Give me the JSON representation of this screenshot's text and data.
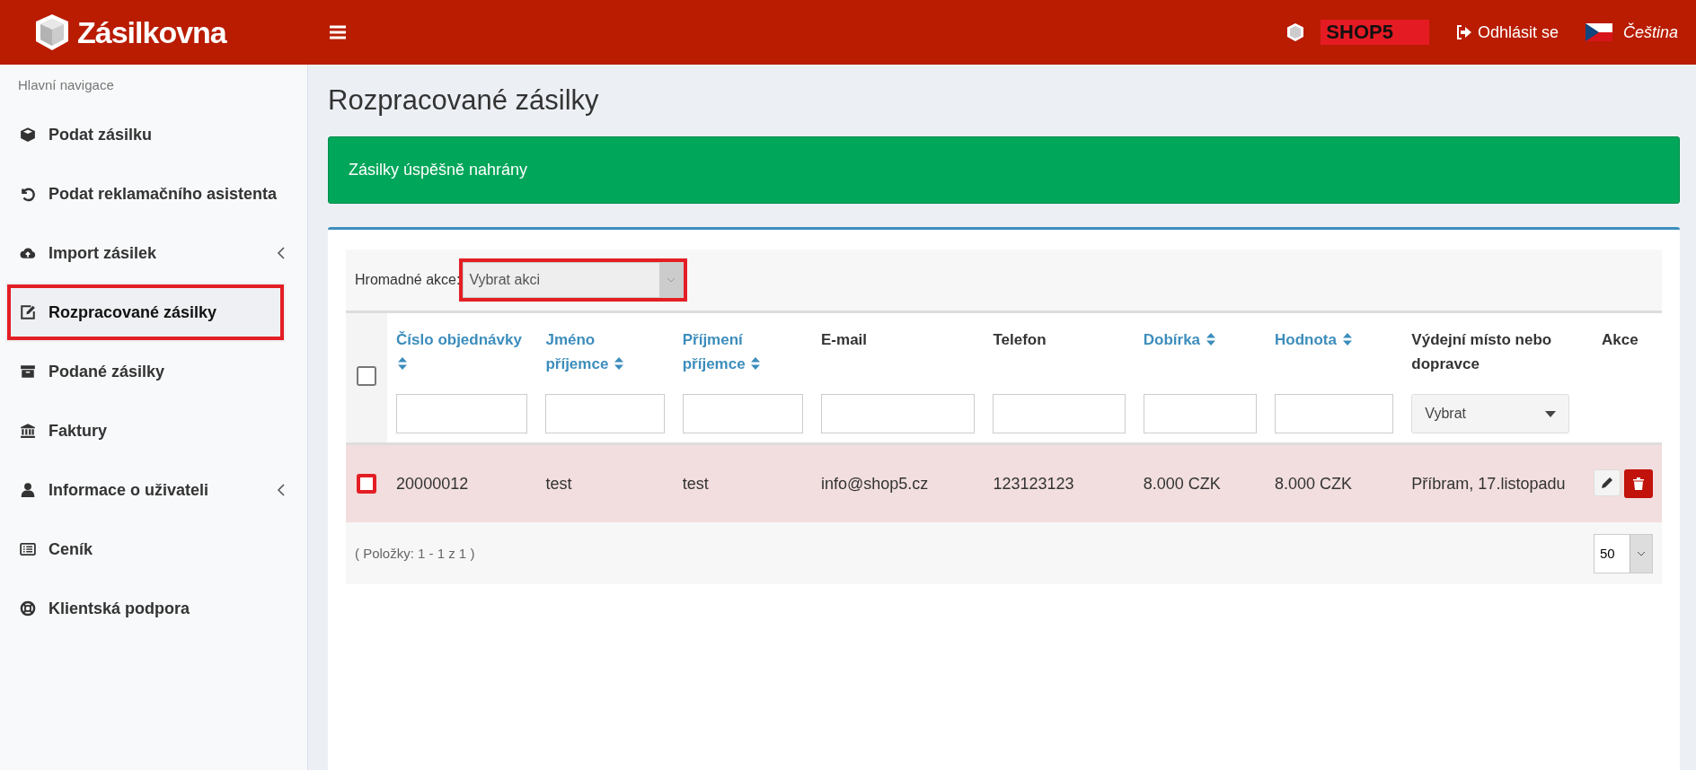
{
  "header": {
    "brand": "Zásilkovna",
    "shop": "SHOP5",
    "logout": "Odhlásit se",
    "language": "Čeština"
  },
  "sidebar": {
    "heading": "Hlavní navigace",
    "items": [
      {
        "label": "Podat zásilku",
        "selected": false,
        "highlighted": false,
        "submenu": false
      },
      {
        "label": "Podat reklamačního asistenta",
        "selected": false,
        "highlighted": false,
        "submenu": false
      },
      {
        "label": "Import zásilek",
        "selected": false,
        "highlighted": false,
        "submenu": true
      },
      {
        "label": "Rozpracované zásilky",
        "selected": true,
        "highlighted": true,
        "submenu": false
      },
      {
        "label": "Podané zásilky",
        "selected": false,
        "highlighted": false,
        "submenu": false
      },
      {
        "label": "Faktury",
        "selected": false,
        "highlighted": false,
        "submenu": false
      },
      {
        "label": "Informace o uživateli",
        "selected": false,
        "highlighted": false,
        "submenu": true
      },
      {
        "label": "Ceník",
        "selected": false,
        "highlighted": false,
        "submenu": false
      },
      {
        "label": "Klientská podpora",
        "selected": false,
        "highlighted": false,
        "submenu": false
      }
    ]
  },
  "page_title": "Rozpracované zásilky",
  "alert": "Zásilky úspěšně nahrány",
  "bulk": {
    "label": "Hromadné akce:",
    "value": "Vybrat akci",
    "highlighted": true
  },
  "table": {
    "select_all_checked": false,
    "columns": [
      {
        "label": "Číslo objednávky",
        "sortable": true,
        "kind": "text"
      },
      {
        "label": "Jméno příjemce",
        "sortable": true,
        "kind": "text"
      },
      {
        "label": "Příjmení příjemce",
        "sortable": true,
        "kind": "text"
      },
      {
        "label": "E-mail",
        "sortable": false,
        "kind": "text"
      },
      {
        "label": "Telefon",
        "sortable": false,
        "kind": "text"
      },
      {
        "label": "Dobírka",
        "sortable": true,
        "kind": "text"
      },
      {
        "label": "Hodnota",
        "sortable": true,
        "kind": "text"
      },
      {
        "label": "Výdejní místo nebo dopravce",
        "sortable": false,
        "kind": "select",
        "filter_value": "Vybrat"
      },
      {
        "label": "Akce",
        "sortable": false,
        "kind": "actions"
      }
    ],
    "rows": [
      {
        "checked": false,
        "highlighted": true,
        "invalid": true,
        "cells": [
          "20000012",
          "test",
          "test",
          "info@shop5.cz",
          "123123123",
          "8.000 CZK",
          "8.000 CZK",
          "Příbram, 17.listopadu"
        ]
      }
    ]
  },
  "footer": {
    "count": "( Položky: 1 - 1 z 1 )",
    "page_size": "50"
  }
}
